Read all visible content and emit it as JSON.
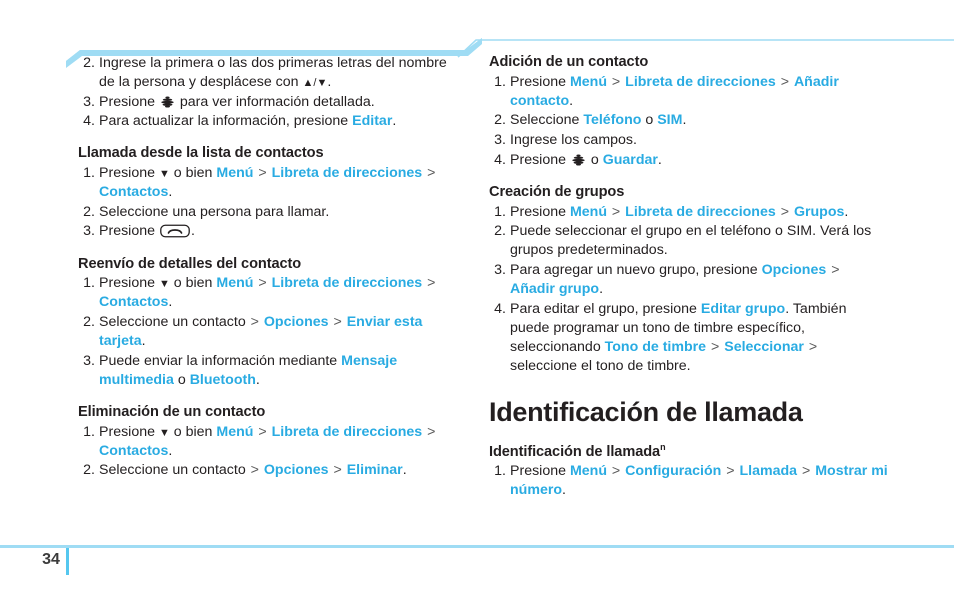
{
  "page": {
    "number": "34",
    "accent_color": "#29abe2",
    "rule_color": "#9fdcf4",
    "text_color": "#231f20"
  },
  "left_column": [
    {
      "type": "list",
      "start": 2,
      "items": [
        {
          "parts": [
            {
              "t": "Ingrese la primera o las dos primeras letras del nombre de la persona y desplácese con "
            },
            {
              "t": "▲/▼",
              "style": "glyph"
            },
            {
              "t": "."
            }
          ]
        },
        {
          "parts": [
            {
              "t": "Presione "
            },
            {
              "t": "att-globe-icon",
              "style": "icon"
            },
            {
              "t": " para ver información detallada."
            }
          ]
        },
        {
          "parts": [
            {
              "t": "Para actualizar la información, presione "
            },
            {
              "t": "Editar",
              "style": "link"
            },
            {
              "t": "."
            }
          ]
        }
      ]
    },
    {
      "type": "heading",
      "text": "Llamada desde la lista de contactos"
    },
    {
      "type": "list",
      "start": 1,
      "items": [
        {
          "parts": [
            {
              "t": "Presione "
            },
            {
              "t": "▼",
              "style": "glyph"
            },
            {
              "t": " o bien "
            },
            {
              "t": "Menú",
              "style": "link"
            },
            {
              "t": ">",
              "style": "sep"
            },
            {
              "t": "Libreta de direcciones",
              "style": "link"
            },
            {
              "t": ">",
              "style": "sep"
            },
            {
              "t": "Contactos",
              "style": "link"
            },
            {
              "t": "."
            }
          ]
        },
        {
          "parts": [
            {
              "t": "Seleccione una persona para llamar."
            }
          ]
        },
        {
          "parts": [
            {
              "t": "Presione "
            },
            {
              "t": "send-key-icon",
              "style": "icon"
            },
            {
              "t": "."
            }
          ]
        }
      ]
    },
    {
      "type": "heading",
      "text": "Reenvío de detalles del contacto"
    },
    {
      "type": "list",
      "start": 1,
      "items": [
        {
          "parts": [
            {
              "t": "Presione "
            },
            {
              "t": "▼",
              "style": "glyph"
            },
            {
              "t": " o bien "
            },
            {
              "t": "Menú",
              "style": "link"
            },
            {
              "t": ">",
              "style": "sep"
            },
            {
              "t": "Libreta de direcciones",
              "style": "link"
            },
            {
              "t": ">",
              "style": "sep"
            },
            {
              "t": "Contactos",
              "style": "link"
            },
            {
              "t": "."
            }
          ]
        },
        {
          "parts": [
            {
              "t": "Seleccione un contacto "
            },
            {
              "t": ">",
              "style": "sep"
            },
            {
              "t": "Opciones",
              "style": "link"
            },
            {
              "t": ">",
              "style": "sep"
            },
            {
              "t": "Enviar esta tarjeta",
              "style": "link"
            },
            {
              "t": "."
            }
          ]
        },
        {
          "parts": [
            {
              "t": "Puede enviar la información mediante "
            },
            {
              "t": "Mensaje multimedia",
              "style": "link"
            },
            {
              "t": " o "
            },
            {
              "t": "Bluetooth",
              "style": "link"
            },
            {
              "t": "."
            }
          ]
        }
      ]
    },
    {
      "type": "heading",
      "text": "Eliminación de un contacto"
    },
    {
      "type": "list",
      "start": 1,
      "items": [
        {
          "parts": [
            {
              "t": "Presione "
            },
            {
              "t": "▼",
              "style": "glyph"
            },
            {
              "t": " o bien "
            },
            {
              "t": "Menú",
              "style": "link"
            },
            {
              "t": ">",
              "style": "sep"
            },
            {
              "t": "Libreta de direcciones",
              "style": "link"
            },
            {
              "t": ">",
              "style": "sep"
            },
            {
              "t": "Contactos",
              "style": "link"
            },
            {
              "t": "."
            }
          ]
        },
        {
          "parts": [
            {
              "t": "Seleccione un contacto "
            },
            {
              "t": ">",
              "style": "sep"
            },
            {
              "t": "Opciones",
              "style": "link"
            },
            {
              "t": ">",
              "style": "sep"
            },
            {
              "t": "Eliminar",
              "style": "link"
            },
            {
              "t": "."
            }
          ]
        }
      ]
    }
  ],
  "right_column": [
    {
      "type": "heading",
      "text": "Adición de un contacto",
      "first": true
    },
    {
      "type": "list",
      "start": 1,
      "items": [
        {
          "parts": [
            {
              "t": "Presione "
            },
            {
              "t": "Menú",
              "style": "link"
            },
            {
              "t": ">",
              "style": "sep"
            },
            {
              "t": "Libreta de direcciones",
              "style": "link"
            },
            {
              "t": ">",
              "style": "sep"
            },
            {
              "t": "Añadir contacto",
              "style": "link"
            },
            {
              "t": "."
            }
          ]
        },
        {
          "parts": [
            {
              "t": "Seleccione "
            },
            {
              "t": "Teléfono",
              "style": "link"
            },
            {
              "t": " o "
            },
            {
              "t": "SIM",
              "style": "link"
            },
            {
              "t": "."
            }
          ]
        },
        {
          "parts": [
            {
              "t": "Ingrese los campos."
            }
          ]
        },
        {
          "parts": [
            {
              "t": "Presione "
            },
            {
              "t": "att-globe-icon",
              "style": "icon"
            },
            {
              "t": " o "
            },
            {
              "t": "Guardar",
              "style": "link"
            },
            {
              "t": "."
            }
          ]
        }
      ]
    },
    {
      "type": "heading",
      "text": "Creación de grupos"
    },
    {
      "type": "list",
      "start": 1,
      "items": [
        {
          "parts": [
            {
              "t": "Presione "
            },
            {
              "t": "Menú",
              "style": "link"
            },
            {
              "t": ">",
              "style": "sep"
            },
            {
              "t": "Libreta de direcciones",
              "style": "link"
            },
            {
              "t": ">",
              "style": "sep"
            },
            {
              "t": "Grupos",
              "style": "link"
            },
            {
              "t": "."
            }
          ]
        },
        {
          "parts": [
            {
              "t": "Puede seleccionar el grupo en el teléfono o SIM. Verá los grupos predeterminados."
            }
          ]
        },
        {
          "parts": [
            {
              "t": "Para agregar un nuevo grupo, presione "
            },
            {
              "t": "Opciones",
              "style": "link"
            },
            {
              "t": ">",
              "style": "sep"
            },
            {
              "t": "Añadir grupo",
              "style": "link"
            },
            {
              "t": "."
            }
          ]
        },
        {
          "parts": [
            {
              "t": "Para editar el grupo, presione "
            },
            {
              "t": "Editar grupo",
              "style": "link"
            },
            {
              "t": ". También puede programar un tono de timbre específico, seleccionando "
            },
            {
              "t": "Tono de timbre",
              "style": "link"
            },
            {
              "t": ">",
              "style": "sep"
            },
            {
              "t": "Seleccionar",
              "style": "link"
            },
            {
              "t": ">",
              "style": "sep"
            },
            {
              "t": "seleccione el tono de timbre."
            }
          ]
        }
      ]
    },
    {
      "type": "section",
      "text": "Identificación de llamada"
    },
    {
      "type": "heading",
      "text": "Identificación de llamada",
      "sup": "n"
    },
    {
      "type": "list",
      "start": 1,
      "items": [
        {
          "parts": [
            {
              "t": "Presione "
            },
            {
              "t": "Menú",
              "style": "link"
            },
            {
              "t": ">",
              "style": "sep"
            },
            {
              "t": "Configuración",
              "style": "link"
            },
            {
              "t": ">",
              "style": "sep"
            },
            {
              "t": "Llamada",
              "style": "link"
            },
            {
              "t": ">",
              "style": "sep"
            },
            {
              "t": "Mostrar mi número",
              "style": "link"
            },
            {
              "t": "."
            }
          ]
        }
      ]
    }
  ]
}
